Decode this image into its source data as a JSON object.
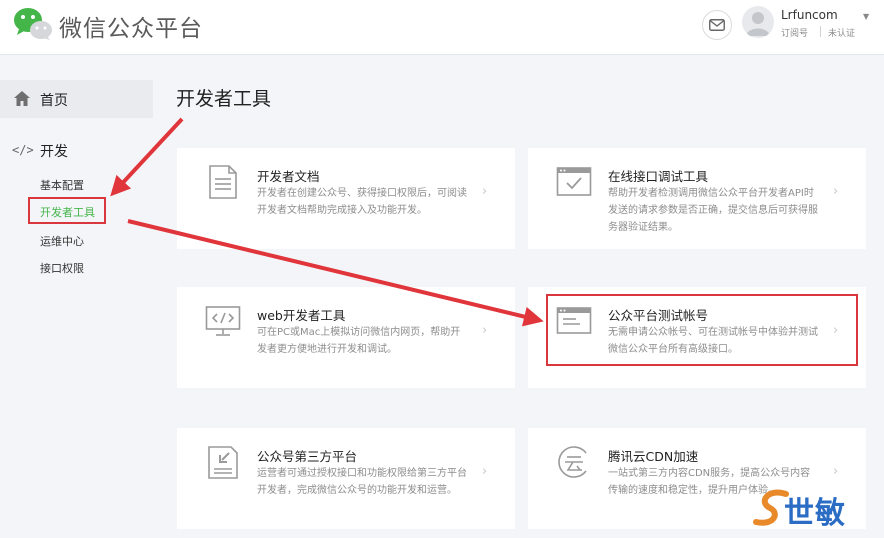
{
  "header": {
    "brand": "微信公众平台",
    "account": {
      "name": "Lrfuncom",
      "type": "订阅号",
      "verify": "未认证"
    }
  },
  "sidebar": {
    "home_label": "首页",
    "dev_icon": "</>",
    "dev_label": "开发",
    "items": [
      {
        "label": "基本配置"
      },
      {
        "label": "开发者工具"
      },
      {
        "label": "运维中心"
      },
      {
        "label": "接口权限"
      }
    ]
  },
  "main": {
    "title": "开发者工具",
    "cards": [
      {
        "icon": "document-icon",
        "title": "开发者文档",
        "desc": "开发者在创建公众号、获得接口权限后，可阅读开发者文档帮助完成接入及功能开发。"
      },
      {
        "icon": "browser-check-icon",
        "title": "在线接口调试工具",
        "desc": "帮助开发者检测调用微信公众平台开发者API时发送的请求参数是否正确，提交信息后可获得服务器验证结果。"
      },
      {
        "icon": "monitor-code-icon",
        "title": "web开发者工具",
        "desc": "可在PC或Mac上模拟访问微信内网页，帮助开发者更方便地进行开发和调试。"
      },
      {
        "icon": "test-account-icon",
        "title": "公众平台测试帐号",
        "desc": "无需申请公众帐号、可在测试帐号中体验并测试微信公众平台所有高级接口。"
      },
      {
        "icon": "third-party-icon",
        "title": "公众号第三方平台",
        "desc": "运营者可通过授权接口和功能权限给第三方平台开发者，完成微信公众号的功能开发和运营。"
      },
      {
        "icon": "cloud-icon",
        "title": "腾讯云CDN加速",
        "desc": "一站式第三方内容CDN服务，提高公众号内容传输的速度和稳定性，提升用户体验。"
      }
    ],
    "chevron": "›"
  },
  "watermark": {
    "text": "世敏"
  },
  "colors": {
    "accent": "#44b549",
    "highlight": "#d9363e",
    "background": "#f4f5f9"
  }
}
